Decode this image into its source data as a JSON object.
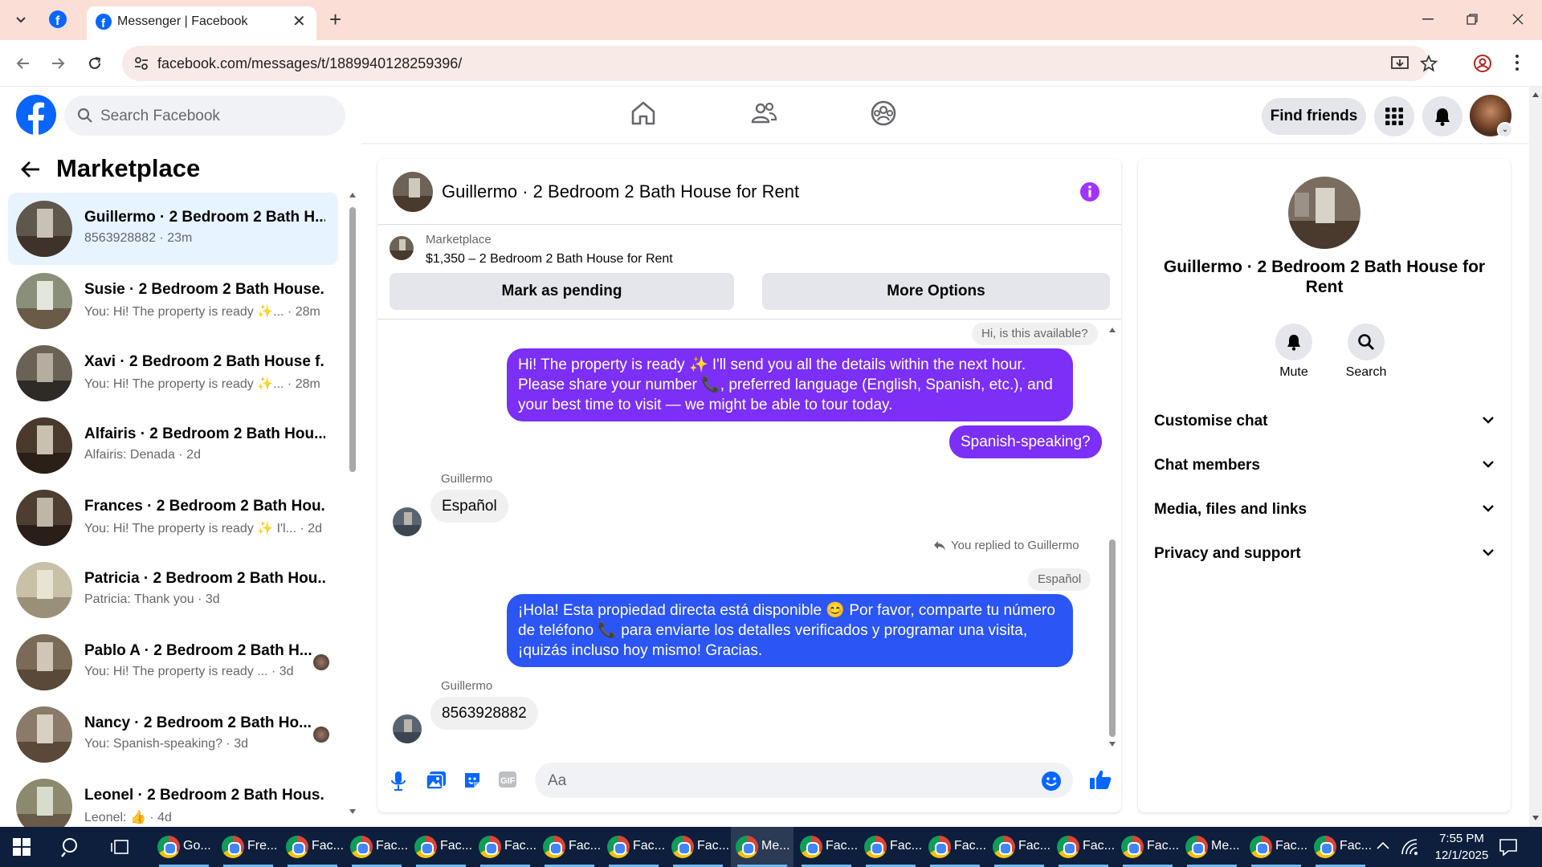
{
  "browser": {
    "tab_title": "Messenger | Facebook",
    "url": "facebook.com/messages/t/1889940128259396/"
  },
  "fb": {
    "search_placeholder": "Search Facebook",
    "find_friends": "Find friends"
  },
  "sidebar": {
    "title": "Marketplace",
    "conversations": [
      {
        "name": "Guillermo · 2 Bedroom 2 Bath H...",
        "preview": "8563928882 · 23m",
        "active": true
      },
      {
        "name": "Susie · 2 Bedroom 2 Bath House...",
        "preview": "You: Hi! The property is ready ✨... · 28m"
      },
      {
        "name": "Xavi · 2 Bedroom 2 Bath House f...",
        "preview": "You: Hi! The property is ready ✨... · 28m"
      },
      {
        "name": "Alfairis · 2 Bedroom 2 Bath Hou...",
        "preview": "Alfairis: Denada · 2d"
      },
      {
        "name": "Frances · 2 Bedroom 2 Bath Hou...",
        "preview": "You: Hi! The property is ready ✨ I'l... · 2d"
      },
      {
        "name": "Patricia · 2 Bedroom 2 Bath Hou...",
        "preview": "Patricia: Thank you · 3d"
      },
      {
        "name": "Pablo A · 2 Bedroom 2 Bath H...",
        "preview": "You: Hi! The property is ready ... · 3d"
      },
      {
        "name": "Nancy · 2 Bedroom 2 Bath Ho...",
        "preview": "You: Spanish-speaking? · 3d"
      },
      {
        "name": "Leonel · 2 Bedroom 2 Bath Hous...",
        "preview": "Leonel: 👍 · 4d"
      }
    ]
  },
  "chat": {
    "title": "Guillermo · 2 Bedroom 2 Bath House for Rent",
    "listing_label": "Marketplace",
    "listing_detail": "$1,350 – 2 Bedroom 2 Bath House for Rent",
    "mark_pending": "Mark as pending",
    "more_options": "More Options",
    "messages": {
      "reply_quote_top": "Hi, is this available?",
      "out1": "Hi! The property is ready ✨ I'll send you all the details within the next hour. Please share your number 📞, preferred language (English, Spanish, etc.), and your best time to visit — we might be able to tour today.",
      "out2": "Spanish-speaking?",
      "sender1": "Guillermo",
      "in1": "Español",
      "replied_to": "You replied to Guillermo",
      "reply_quote": "Español",
      "out3": "¡Hola! Esta propiedad directa está disponible 😊 Por favor, comparte tu número de teléfono 📞 para enviarte los detalles verificados y programar una visita, ¡quizás incluso hoy mismo! Gracias.",
      "sender2": "Guillermo",
      "in2": "8563928882"
    },
    "composer_placeholder": "Aa"
  },
  "info_panel": {
    "name": "Guillermo · 2 Bedroom 2 Bath House for Rent",
    "mute": "Mute",
    "search": "Search",
    "sections": [
      "Customise chat",
      "Chat members",
      "Media, files and links",
      "Privacy and support"
    ]
  },
  "taskbar": {
    "apps": [
      {
        "label": "Go..."
      },
      {
        "label": "Fre..."
      },
      {
        "label": "Fac..."
      },
      {
        "label": "Fac..."
      },
      {
        "label": "Fac..."
      },
      {
        "label": "Fac..."
      },
      {
        "label": "Fac..."
      },
      {
        "label": "Fac..."
      },
      {
        "label": "Fac..."
      },
      {
        "label": "Me...",
        "active": true
      },
      {
        "label": "Fac..."
      },
      {
        "label": "Fac..."
      },
      {
        "label": "Fac..."
      },
      {
        "label": "Fac..."
      },
      {
        "label": "Fac..."
      },
      {
        "label": "Fac..."
      },
      {
        "label": "Me..."
      },
      {
        "label": "Fac..."
      },
      {
        "label": "Fac..."
      }
    ],
    "time": "7:55 PM",
    "date": "12/1/2025"
  },
  "colors": {
    "fb_blue": "#0866ff",
    "messenger_purple": "#8a2be2",
    "messenger_blue": "#2b5cff",
    "info_icon": "#a033ff"
  }
}
